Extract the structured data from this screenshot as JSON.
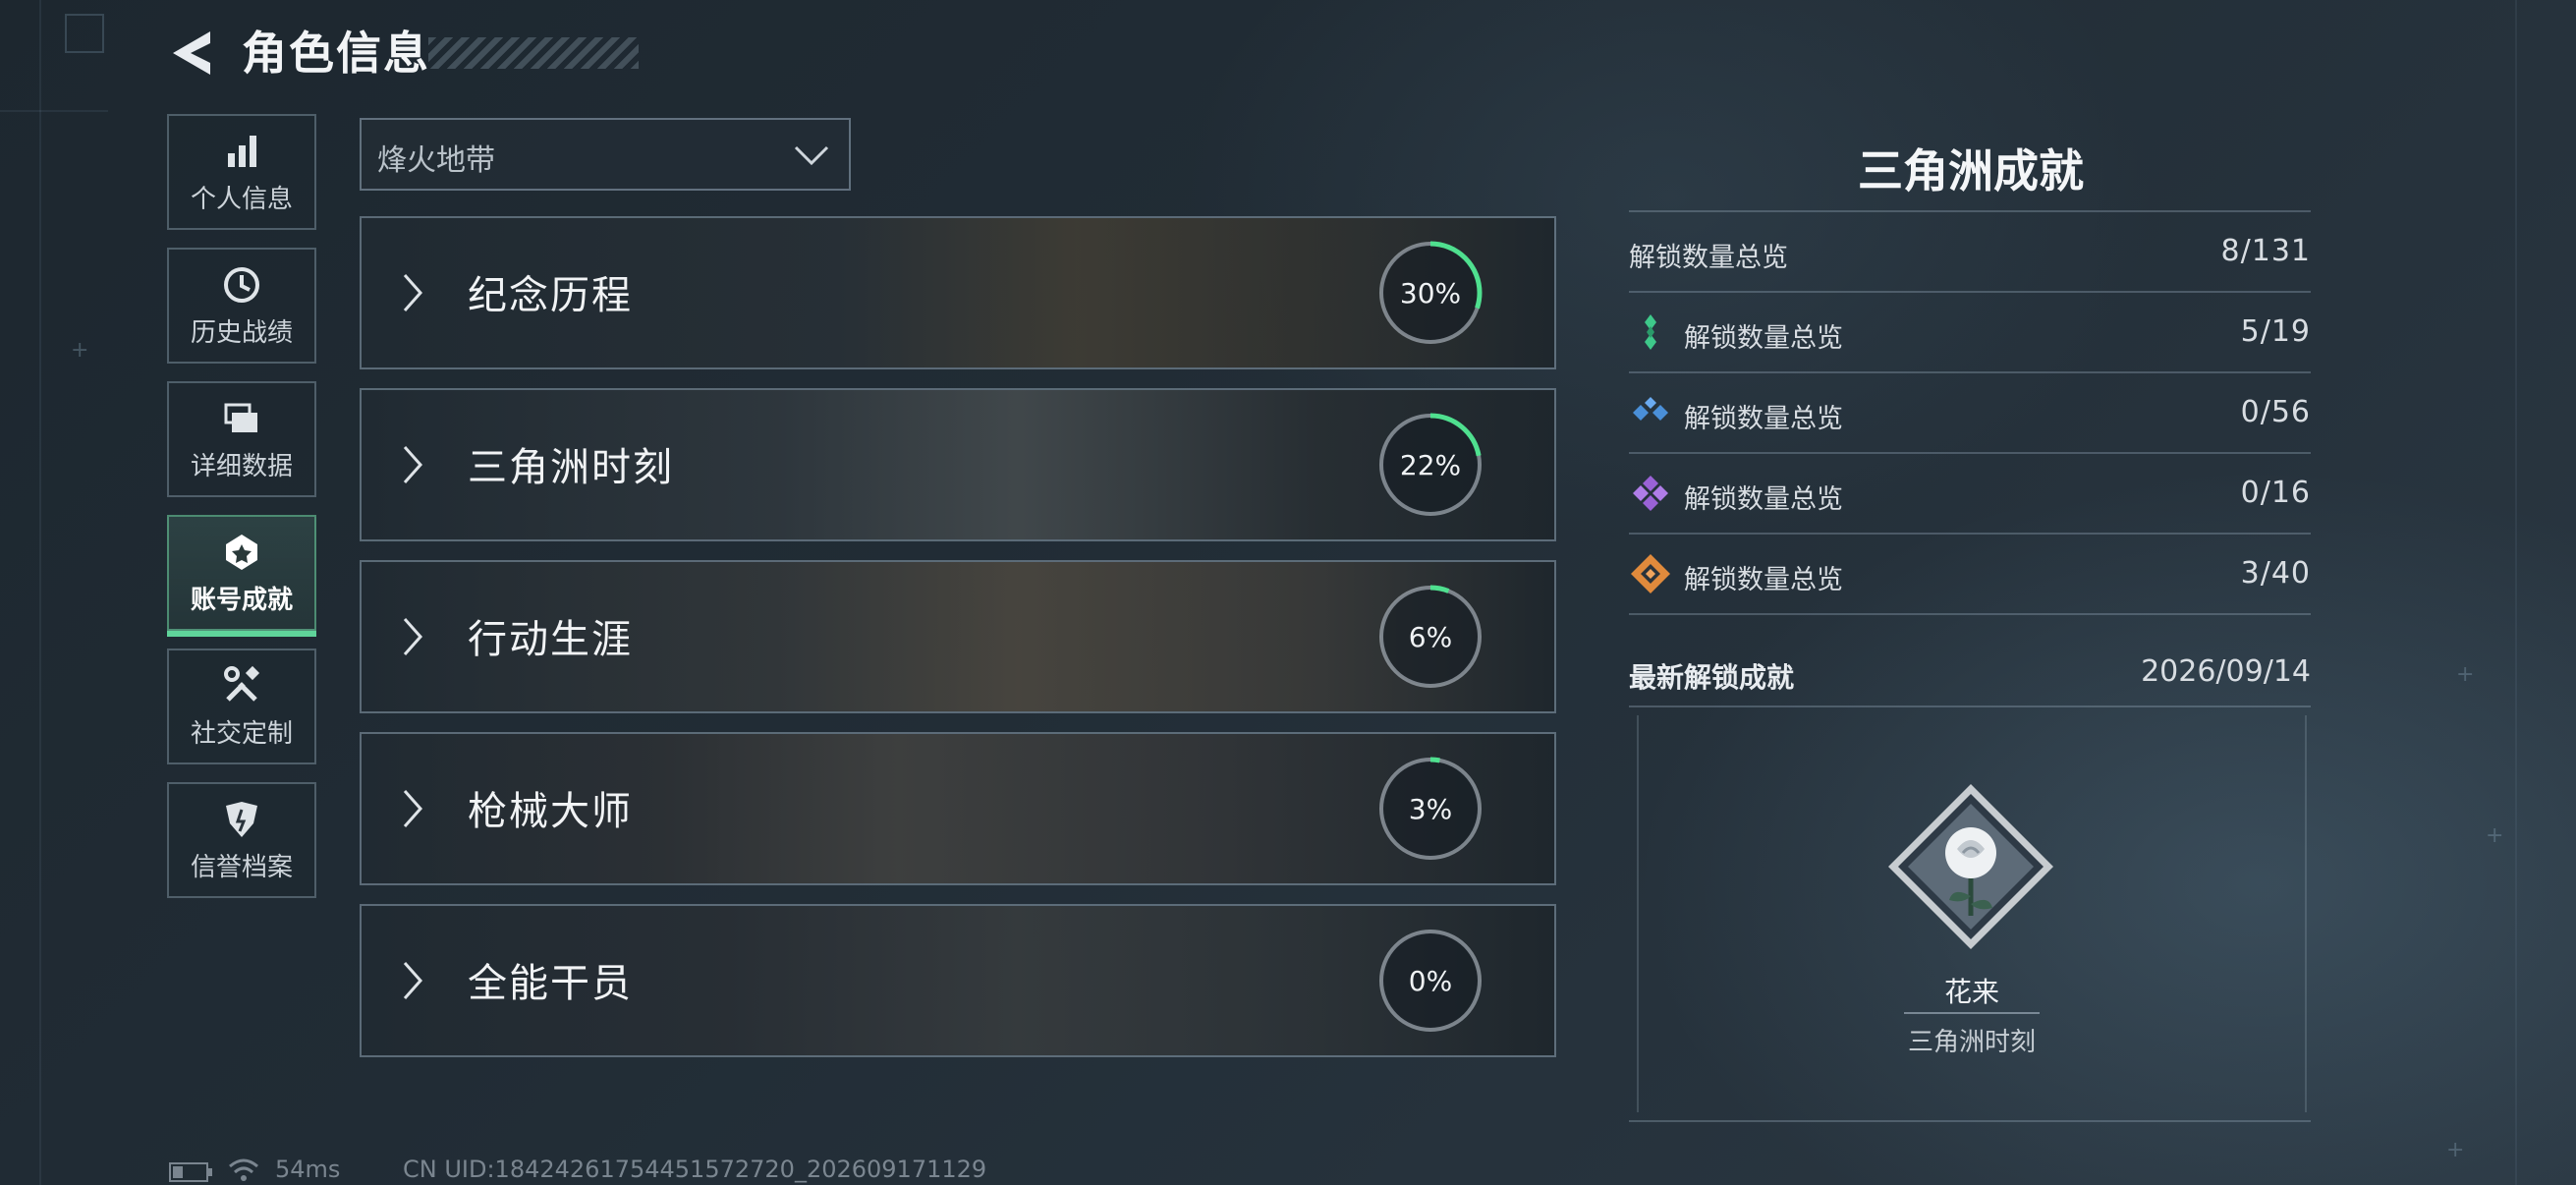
{
  "header": {
    "title": "角色信息"
  },
  "sidebar": {
    "items": [
      {
        "label": "个人信息",
        "icon": "bar-chart-icon"
      },
      {
        "label": "历史战绩",
        "icon": "clock-history-icon"
      },
      {
        "label": "详细数据",
        "icon": "stacked-cards-icon"
      },
      {
        "label": "账号成就",
        "icon": "achievement-badge-icon",
        "active": true
      },
      {
        "label": "社交定制",
        "icon": "wrench-tools-icon"
      },
      {
        "label": "信誉档案",
        "icon": "shield-emblem-icon"
      }
    ]
  },
  "mode_select": {
    "value": "烽火地带"
  },
  "categories": [
    {
      "name": "纪念历程",
      "progress_text": "30%",
      "progress": 30
    },
    {
      "name": "三角洲时刻",
      "progress_text": "22%",
      "progress": 22
    },
    {
      "name": "行动生涯",
      "progress_text": "6%",
      "progress": 6
    },
    {
      "name": "枪械大师",
      "progress_text": "3%",
      "progress": 3
    },
    {
      "name": "全能干员",
      "progress_text": "0%",
      "progress": 0
    }
  ],
  "summary": {
    "title": "三角洲成就",
    "total": {
      "label": "解锁数量总览",
      "value": "8/131"
    },
    "tiers": [
      {
        "label": "解锁数量总览",
        "value": "5/19",
        "color": "#3ec98a",
        "icon": "green-gem-icon"
      },
      {
        "label": "解锁数量总览",
        "value": "0/56",
        "color": "#4a8fd8",
        "icon": "blue-gem-icon"
      },
      {
        "label": "解锁数量总览",
        "value": "0/16",
        "color": "#9a62d6",
        "icon": "purple-gem-icon"
      },
      {
        "label": "解锁数量总览",
        "value": "3/40",
        "color": "#e08a3c",
        "icon": "orange-gem-icon"
      }
    ],
    "latest": {
      "label": "最新解锁成就",
      "date": "2026/09/14",
      "name": "花来",
      "category": "三角洲时刻",
      "icon": "rose-badge-icon"
    }
  },
  "footer": {
    "ping": "54ms",
    "uid": "CN UID:1842426175445157272​0_202609171129"
  }
}
